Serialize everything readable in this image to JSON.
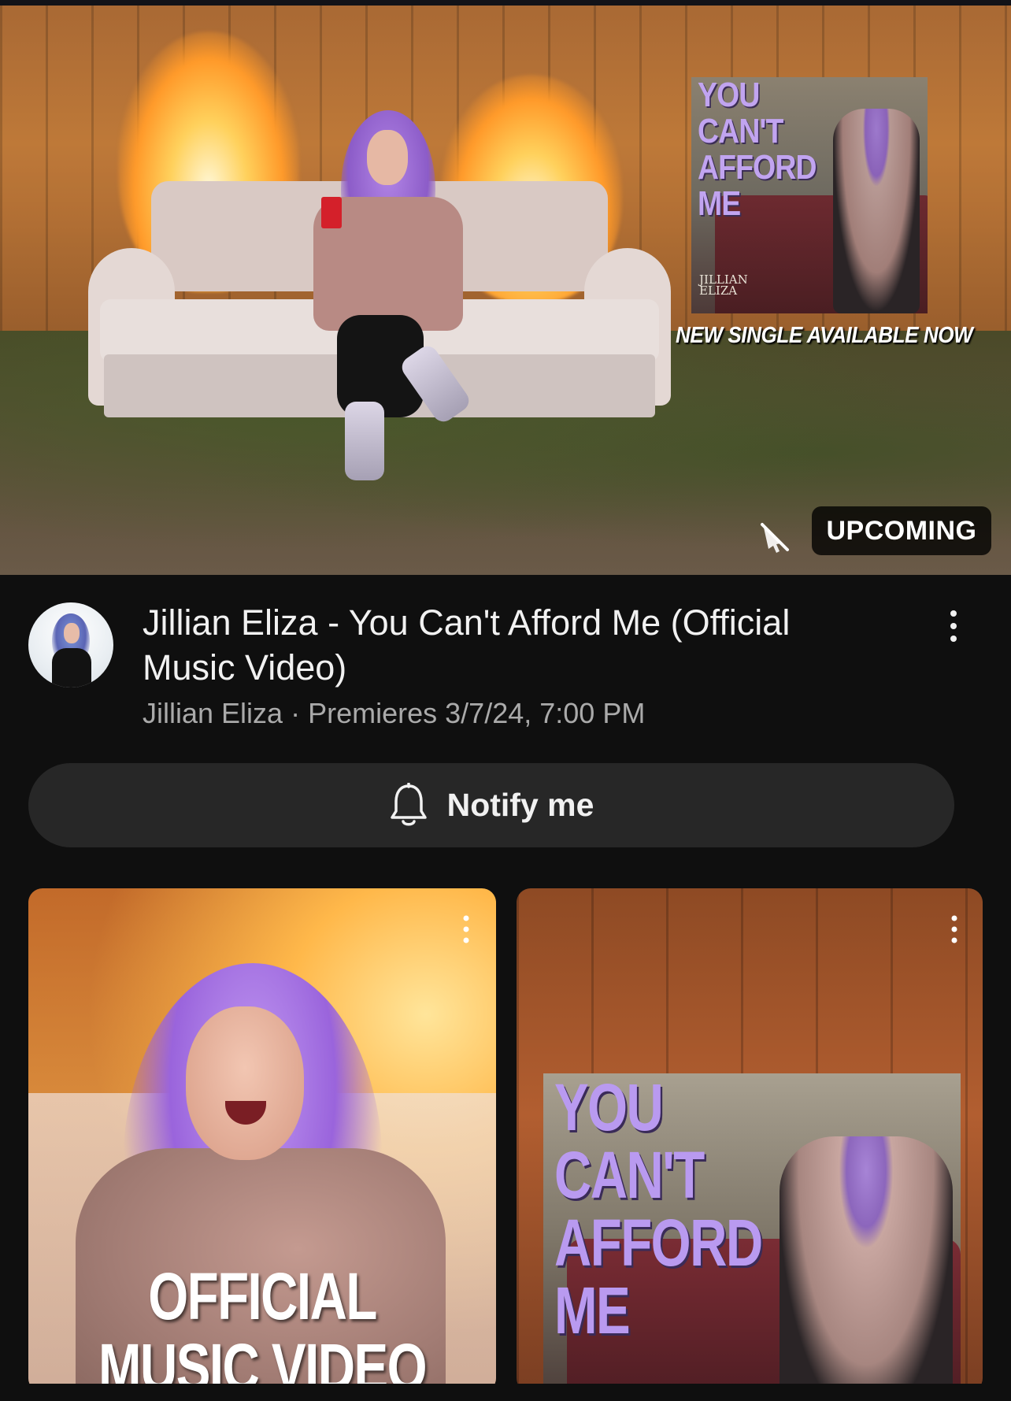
{
  "hero": {
    "cover_title_lines": [
      "YOU CAN'T",
      "AFFORD",
      "ME"
    ],
    "cover_logo_lines": [
      "JILLIAN",
      "ELIZA"
    ],
    "cover_caption": "NEW SINGLE AVAILABLE NOW",
    "status_badge": "UPCOMING",
    "muted_icon": "volume-off-icon"
  },
  "video": {
    "title": "Jillian Eliza - You Can't Afford Me (Official Music Video)",
    "channel": "Jillian Eliza",
    "separator": "·",
    "premiere": "Premieres 3/7/24, 7:00 PM",
    "more_icon": "more-vert-icon"
  },
  "notify": {
    "label": "Notify me",
    "icon": "bell-icon"
  },
  "shorts": [
    {
      "overlay_lines": [
        "OFFICIAL",
        "MUSIC VIDEO"
      ]
    },
    {
      "poster_title_lines": [
        "YOU CAN'T",
        "AFFORD",
        "ME"
      ]
    }
  ],
  "colors": {
    "background": "#0f0f0f",
    "button_bg": "#272727",
    "title_text": "#f1f1f1",
    "meta_text": "#aaaaaa",
    "badge_bg": "#000000",
    "poster_title": "#b99af0"
  }
}
